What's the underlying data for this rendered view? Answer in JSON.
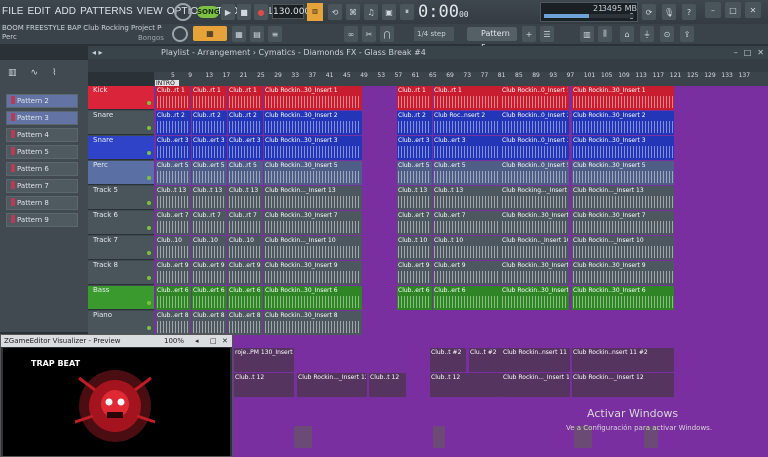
{
  "menu": [
    "FILE",
    "EDIT",
    "ADD",
    "PATTERNS",
    "VIEW",
    "OPTIONS",
    "TOOLS",
    "HELP"
  ],
  "transport": {
    "song_label": "SONG",
    "tempo": "130.000",
    "time": "0:00",
    "time_sub": "00",
    "time_unit": "M:S:CS"
  },
  "memory": {
    "top": "21",
    "value": "3495 MB",
    "sub": "0",
    "fill": 0.5
  },
  "project": {
    "title": "BOOM FREESTYLE BAP Club Rocking Project POLAR.f",
    "channel": "Perc",
    "instrument": "Bongos"
  },
  "toolbar2": {
    "snap": "1/4 step",
    "pattern": "Pattern 5"
  },
  "playlist": {
    "path": "Playlist - Arrangement › Cymatics - Diamonds FX - Glass Break #4",
    "marker": "INTRO"
  },
  "browser": {
    "patterns": [
      "Pattern 2",
      "Pattern 3",
      "Pattern 4",
      "Pattern 5",
      "Pattern 6",
      "Pattern 7",
      "Pattern 8",
      "Pattern 9"
    ]
  },
  "tracks": [
    "Kick",
    "Snare",
    "Snare",
    "Perc",
    "Track 5",
    "Track 6",
    "Track 7",
    "Track 8",
    "Bass",
    "Piano"
  ],
  "ruler": [
    "5",
    "9",
    "13",
    "17",
    "21",
    "25",
    "29",
    "33",
    "37",
    "41",
    "45",
    "49",
    "53",
    "57",
    "61",
    "65",
    "69",
    "73",
    "77",
    "81",
    "85",
    "89",
    "93",
    "97",
    "101",
    "105",
    "109",
    "113",
    "117",
    "121",
    "125",
    "129",
    "133",
    "137"
  ],
  "clip_labels": {
    "kick": [
      "Club..rt 1",
      "Club..rt 1",
      "Club..rt 1",
      "Club Rockin..30_Insert 1",
      "Club..rt 1",
      "Club..rt 1",
      "Club Rockin..0_Insert 1",
      "Club Rockin..30_Insert 1"
    ],
    "snare": [
      "Club..rt 2",
      "Club..rt 2",
      "Club..rt 2",
      "Club Rockin..30_Insert 2",
      "Club..rt 2",
      "Club Roc..nsert 2",
      "Club Rockin..0_Insert 2",
      "Club Rockin..30_Insert 2"
    ],
    "snare2": [
      "Club..ert 3",
      "Club..ert 3",
      "Club..ert 3",
      "Club Rockin..30_Insert 3",
      "Club..ert 3",
      "Club..ert 3",
      "Club Rockin..0_Insert 3",
      "Club Rockin..30_Insert 3"
    ],
    "perc": [
      "Club..ert 5",
      "Club..ert 5",
      "Club..rt 5",
      "Club Rockin..30_Insert 5",
      "Club..ert 5",
      "Club..ert 5",
      "Club Rockin..0_Insert 5",
      "Club Rockin..30_Insert 5"
    ],
    "t5": [
      "Club..t 13",
      "Club..t 13",
      "Club..t 13",
      "Club Rockin..._Insert 13",
      "Club..t 13",
      "Club..t 13",
      "Club Rocking..._Insert 13",
      "Club Rockin..._Insert 13"
    ],
    "t6": [
      "Club..ert 7",
      "Club..rt 7",
      "Club..rt 7",
      "Club Rockin..30_Insert 7",
      "Club..ert 7",
      "Club..ert 7",
      "Club Rockin..30_Insert 7",
      "Club Rockin..30_Insert 7"
    ],
    "t7": [
      "Club..10",
      "Club..10",
      "Club..10",
      "Club Rockin..._Insert 10",
      "Club..t 10",
      "Club..t 10",
      "Club Rockin.._Insert 10",
      "Club Rockin..._Insert 10"
    ],
    "t8": [
      "Club..ert 9",
      "Club..ert 9",
      "Club..ert 9",
      "Club Rockin..30_Insert 9",
      "Club..ert 9",
      "Club..ert 9",
      "Club Rockin..30_Insert 9",
      "Club Rockin..30_Insert 9"
    ],
    "bass": [
      "Club..ert 6",
      "Club..ert 6",
      "Club..ert 6",
      "Club Rockin..30_Insert 6",
      "Club..ert 6",
      "Club..ert 6",
      "Club Rockin..30_Insert 6",
      "Club Rockin..30_Insert 6"
    ],
    "piano": [
      "Club..ert 8",
      "Club..ert 8",
      "Club..ert 8",
      "Club Rockin..30_Insert 8",
      "Club..ert 8",
      "Club..ert 8",
      "Club Rockin..30_Insert 8",
      "Club Rockin..30_Insert 8"
    ]
  },
  "lower_labels": {
    "r1": [
      "roje..PM 130_Insert 11",
      "Club..t #2",
      "Clu..t #2",
      "Club Rockin..nsert 11 #2",
      "Club Rockin..nsert 11 #2"
    ],
    "r2": [
      "Club..t 12",
      "Club Rockin..._Insert 12",
      "Club..t 12",
      "Club..t 12",
      "Club Rockin..._Insert 12",
      "Club Rockin..._Insert 12"
    ]
  },
  "preview": {
    "title": "ZGameEditor Visualizer - Preview",
    "zoom": "100%",
    "art_title": "TRAP BEAT"
  },
  "watermark": {
    "line1": "Activar Windows",
    "line2": "Ve a Configuración para activar Windows."
  },
  "colors": {
    "kick": "#d9243a",
    "snare": "#2f43c9",
    "perc": "#5a6fa3",
    "bass": "#3a9a2e",
    "grid": "#7a2fa0",
    "clip": "#5b6870"
  }
}
